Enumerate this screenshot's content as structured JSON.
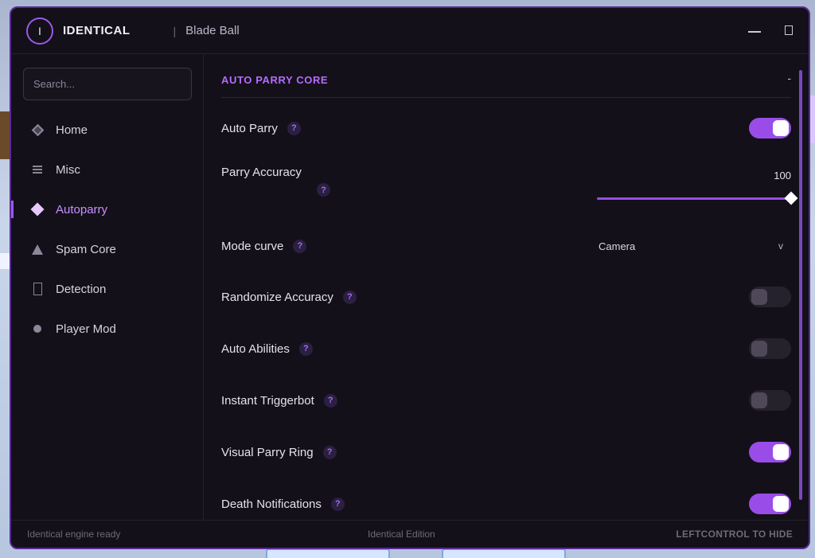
{
  "titlebar": {
    "logo_letter": "I",
    "brand": "IDENTICAL",
    "separator": "|",
    "game": "Blade Ball"
  },
  "sidebar": {
    "search_placeholder": "Search...",
    "items": [
      {
        "label": "Home",
        "icon": "diamond-outline-icon"
      },
      {
        "label": "Misc",
        "icon": "menu-lines-icon"
      },
      {
        "label": "Autoparry",
        "icon": "diamond-icon",
        "active": true
      },
      {
        "label": "Spam Core",
        "icon": "triangle-icon"
      },
      {
        "label": "Detection",
        "icon": "rectangle-icon"
      },
      {
        "label": "Player Mod",
        "icon": "dot-icon"
      }
    ]
  },
  "section": {
    "title": "AUTO PARRY CORE",
    "collapse": "-"
  },
  "settings": {
    "auto_parry": {
      "label": "Auto Parry",
      "help": "?",
      "enabled": true
    },
    "parry_accuracy": {
      "label": "Parry Accuracy",
      "help": "?",
      "value": "100",
      "max": 100
    },
    "mode_curve": {
      "label": "Mode curve",
      "help": "?",
      "value": "Camera",
      "caret": "v"
    },
    "randomize_accuracy": {
      "label": "Randomize Accuracy",
      "help": "?",
      "enabled": false
    },
    "auto_abilities": {
      "label": "Auto Abilities",
      "help": "?",
      "enabled": false
    },
    "instant_triggerbot": {
      "label": "Instant Triggerbot",
      "help": "?",
      "enabled": false
    },
    "visual_parry_ring": {
      "label": "Visual Parry Ring",
      "help": "?",
      "enabled": true
    },
    "death_notifications": {
      "label": "Death Notifications",
      "help": "?",
      "enabled": true
    }
  },
  "footer": {
    "status": "Identical engine ready",
    "edition": "Identical Edition",
    "hint": "LEFTCONTROL TO HIDE"
  },
  "colors": {
    "accent": "#9a4ce8",
    "accent_text": "#b46cff",
    "background": "#131019",
    "border": "#5b2a96"
  }
}
